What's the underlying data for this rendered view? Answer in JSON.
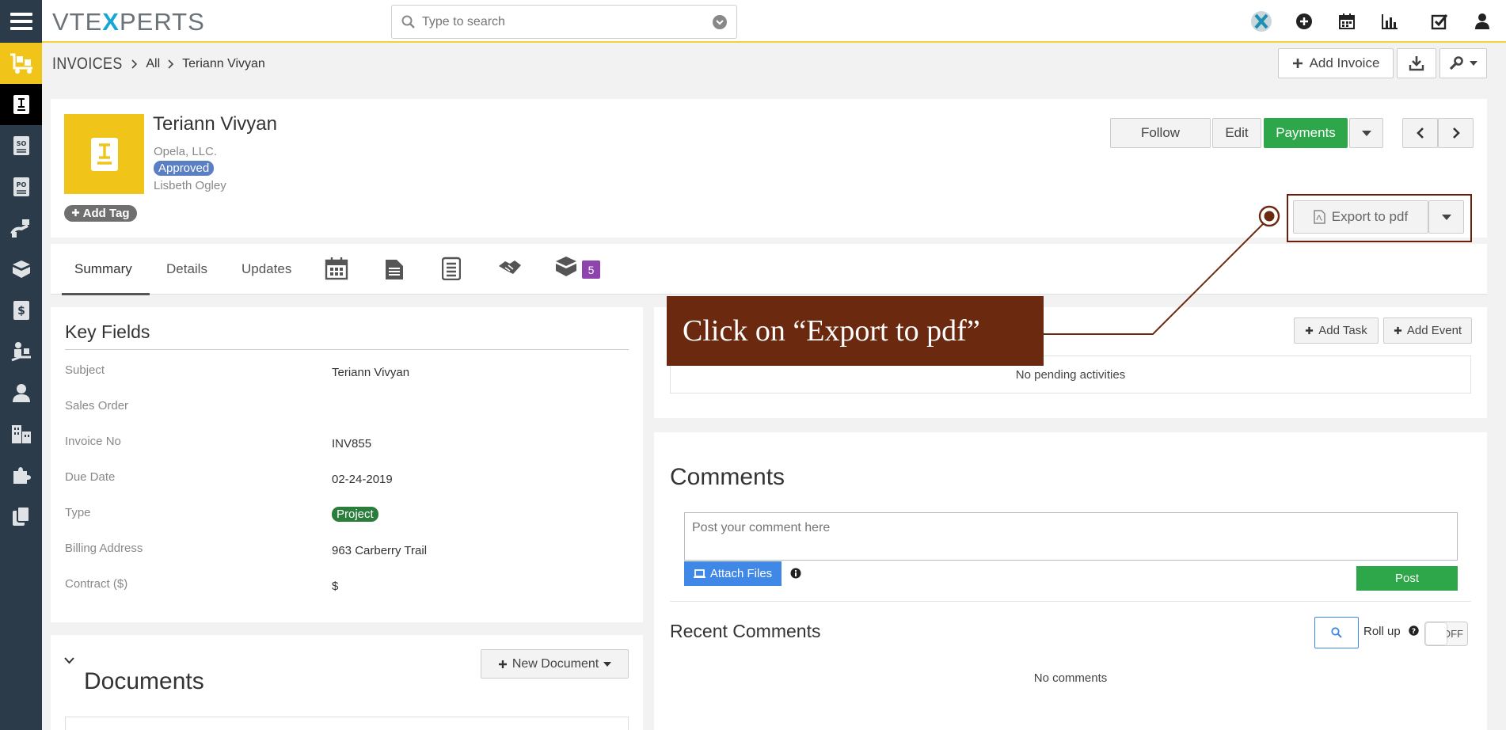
{
  "topbar": {
    "logo_left": "VTE",
    "logo_x": "X",
    "logo_right": "PERTS",
    "search_placeholder": "Type to search"
  },
  "breadcrumb": {
    "module": "INVOICES",
    "filter": "All",
    "record": "Teriann Vivyan"
  },
  "header_actions": {
    "add_invoice": "Add Invoice"
  },
  "record": {
    "name": "Teriann Vivyan",
    "organization": "Opela, LLC.",
    "status": "Approved",
    "owner": "Lisbeth Ogley",
    "add_tag": "Add Tag"
  },
  "record_actions": {
    "follow": "Follow",
    "edit": "Edit",
    "payments": "Payments",
    "export_pdf": "Export to pdf"
  },
  "tabs": {
    "summary": "Summary",
    "details": "Details",
    "updates": "Updates",
    "badge_count": "5"
  },
  "key_fields": {
    "title": "Key Fields",
    "rows": [
      {
        "label": "Subject",
        "value": "Teriann Vivyan"
      },
      {
        "label": "Sales Order",
        "value": ""
      },
      {
        "label": "Invoice No",
        "value": "INV855"
      },
      {
        "label": "Due Date",
        "value": "02-24-2019"
      },
      {
        "label": "Type",
        "value": "Project"
      },
      {
        "label": "Billing Address",
        "value": "963 Carberry Trail"
      },
      {
        "label": "Contract ($)",
        "value": "$"
      }
    ]
  },
  "documents": {
    "title": "Documents",
    "new_document": "New Document"
  },
  "activities": {
    "add_task": "Add Task",
    "add_event": "Add Event",
    "empty": "No pending activities"
  },
  "comments": {
    "title": "Comments",
    "placeholder": "Post your comment here",
    "attach_files": "Attach Files",
    "post": "Post",
    "recent_title": "Recent Comments",
    "roll_up": "Roll up",
    "toggle_state": "OFF",
    "empty": "No comments"
  },
  "tutorial": {
    "callout": "Click on “Export to pdf”"
  },
  "colors": {
    "sidebar": "#2c3b49",
    "accent_yellow": "#f0c419",
    "payments_green": "#2ea64a",
    "callout_brown": "#6b2a0f",
    "link_blue": "#3f88e8"
  }
}
